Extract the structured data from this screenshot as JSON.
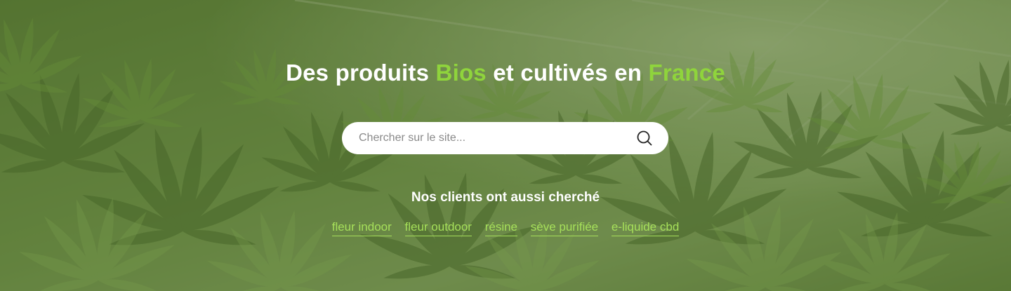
{
  "hero": {
    "headline": {
      "part1": "Des produits ",
      "accent1": "Bios",
      "part2": " et cultivés en ",
      "accent2": "France"
    },
    "accent_color": "#8fd43c",
    "background_image": "cannabis-greenhouse-photo"
  },
  "search": {
    "placeholder": "Chercher sur le site...",
    "value": "",
    "icon": "search-icon"
  },
  "suggestions": {
    "title": "Nos clients ont aussi cherché",
    "tags": [
      "fleur indoor",
      "fleur outdoor",
      "résine",
      "sève purifiée",
      "e-liquide cbd"
    ],
    "link_color": "#a6e05a"
  }
}
